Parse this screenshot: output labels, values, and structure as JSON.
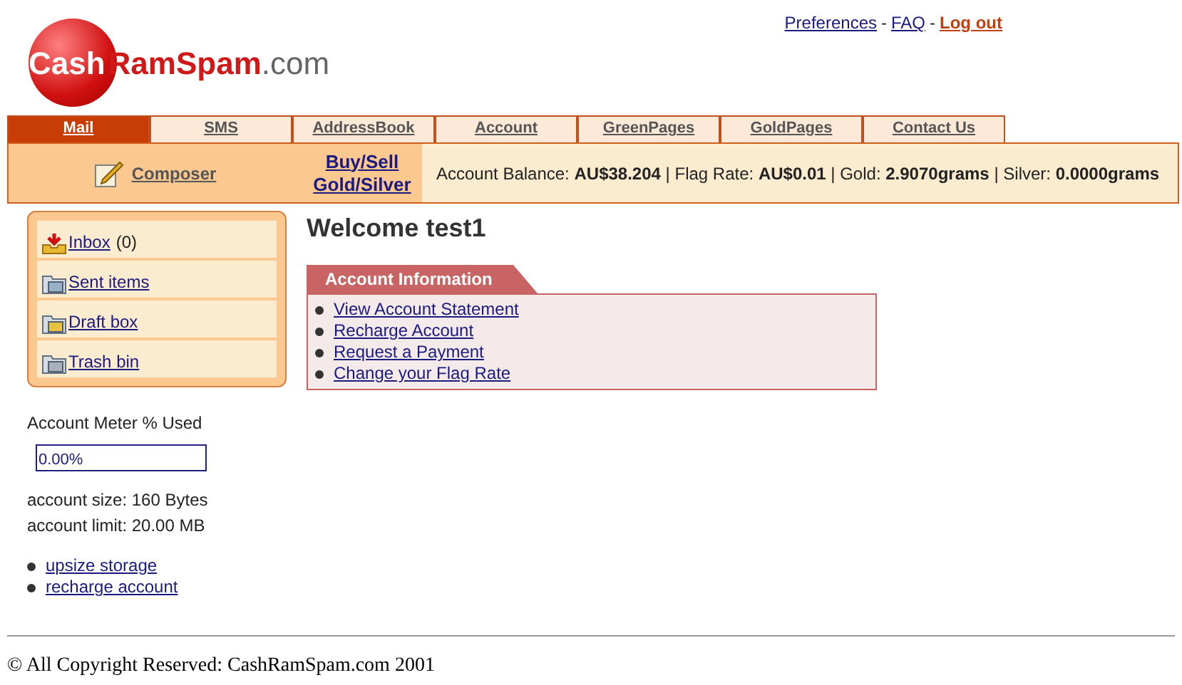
{
  "logo": {
    "part_1": "Cash",
    "part_2": "RamSpam",
    "part_3": ".com"
  },
  "top_links": [
    {
      "label": "Preferences",
      "kind": "normal"
    },
    {
      "label": "FAQ",
      "kind": "normal"
    },
    {
      "label": "Log out",
      "kind": "logout"
    }
  ],
  "top_separator": "-",
  "tabs": [
    {
      "label": "Mail",
      "selected": true
    },
    {
      "label": "SMS",
      "selected": false
    },
    {
      "label": "AddressBook",
      "selected": false
    },
    {
      "label": "Account",
      "selected": false
    },
    {
      "label": "GreenPages",
      "selected": false
    },
    {
      "label": "GoldPages",
      "selected": false
    },
    {
      "label": "Contact Us",
      "selected": false
    }
  ],
  "toolbar": {
    "composer": "Composer",
    "buy_sell": [
      "Buy/Sell",
      "Gold/Silver"
    ],
    "balance": "Account Balance: **AU$38.204** | Flag Rate: **AU$0.01** | Gold: **2.9070grams** | Silver: **0.0000grams**"
  },
  "folders": [
    {
      "label": "Inbox",
      "count": "(0)",
      "kind": "inbox"
    },
    {
      "label": "Sent items",
      "kind": "sent"
    },
    {
      "label": "Draft box",
      "kind": "draft"
    },
    {
      "label": "Trash bin",
      "kind": "trash"
    }
  ],
  "meter": {
    "title": "Account Meter % Used",
    "reading": "0.00%"
  },
  "account_size": "account size: 160 Bytes",
  "account_limit": "account limit: 20.00 MB",
  "side_links": [
    "upsize storage",
    "recharge account"
  ],
  "welcome": "Welcome test1",
  "account_info": {
    "title": "Account Information",
    "links": [
      "View Account Statement",
      "Recharge Account",
      "Request a Payment",
      "Change your Flag Rate"
    ]
  },
  "footer": "© All Copyright Reserved: CashRamSpam.com 2001"
}
